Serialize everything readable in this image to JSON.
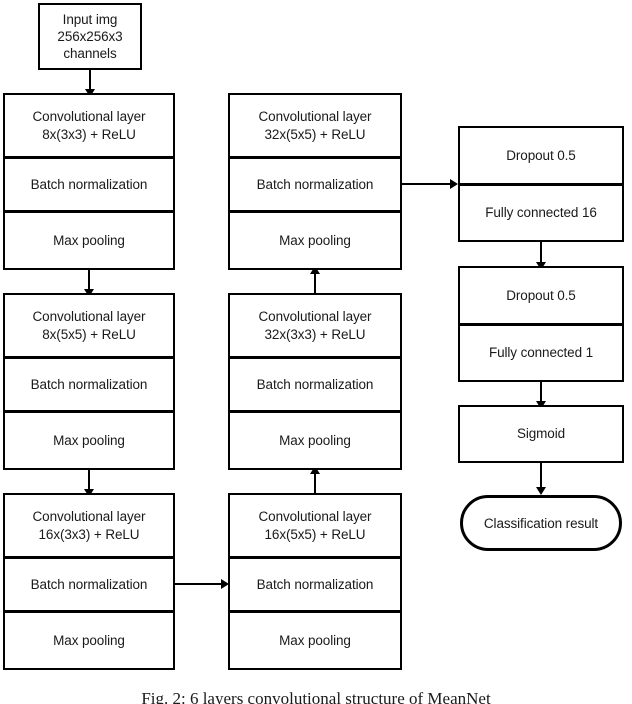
{
  "figure": {
    "caption": "Fig. 2: 6 layers convolutional structure of MeanNet"
  },
  "diagram": {
    "type": "flowchart",
    "orientation": "three-column serpentine",
    "input": {
      "label": "Input img\n256x256x3\nchannels",
      "line1": "Input img",
      "line2": "256x256x3",
      "line3": "channels"
    },
    "column_left": {
      "blocks": [
        {
          "id": "block-1",
          "conv_line1": "Convolutional layer",
          "conv_line2": "8x(3x3) + ReLU",
          "batchnorm": "Batch normalization",
          "pooling": "Max pooling"
        },
        {
          "id": "block-2",
          "conv_line1": "Convolutional layer",
          "conv_line2": "8x(5x5) + ReLU",
          "batchnorm": "Batch normalization",
          "pooling": "Max pooling"
        },
        {
          "id": "block-3",
          "conv_line1": "Convolutional layer",
          "conv_line2": "16x(3x3) + ReLU",
          "batchnorm": "Batch normalization",
          "pooling": "Max pooling"
        }
      ]
    },
    "column_middle": {
      "blocks": [
        {
          "id": "block-6",
          "conv_line1": "Convolutional layer",
          "conv_line2": "32x(5x5) + ReLU",
          "batchnorm": "Batch normalization",
          "pooling": "Max pooling"
        },
        {
          "id": "block-5",
          "conv_line1": "Convolutional layer",
          "conv_line2": "32x(3x3) + ReLU",
          "batchnorm": "Batch normalization",
          "pooling": "Max pooling"
        },
        {
          "id": "block-4",
          "conv_line1": "Convolutional layer",
          "conv_line2": "16x(5x5) + ReLU",
          "batchnorm": "Batch normalization",
          "pooling": "Max pooling"
        }
      ]
    },
    "column_right": {
      "head_group": {
        "dropout": "Dropout 0.5",
        "dense": "Fully connected 16"
      },
      "second_group": {
        "dropout": "Dropout 0.5",
        "dense": "Fully connected 1"
      },
      "activation": "Sigmoid",
      "output": "Classification result"
    },
    "colors": {
      "stroke": "#000000",
      "fill": "#ffffff",
      "text": "#1a1a1a"
    }
  }
}
